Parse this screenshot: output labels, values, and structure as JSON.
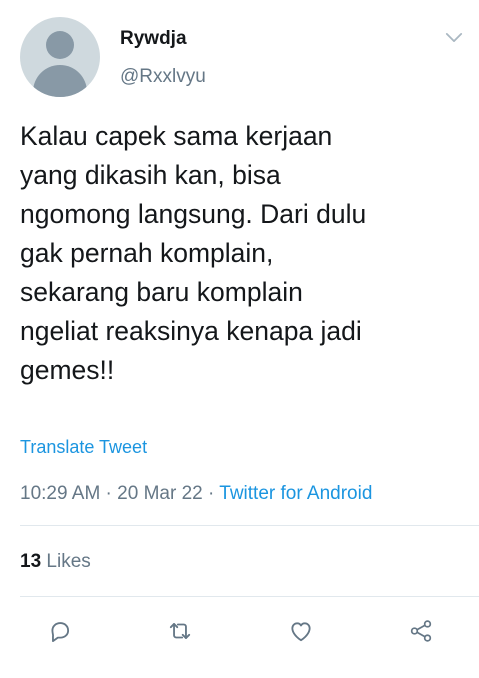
{
  "author": {
    "display_name": "Rywdja",
    "handle": "@Rxxlvyu"
  },
  "icons": {
    "caret": "chevron-down-icon",
    "reply": "reply-icon",
    "retweet": "retweet-icon",
    "like": "heart-icon",
    "share": "share-icon"
  },
  "tweet": {
    "text": "Kalau capek sama kerjaan\nyang dikasih kan, bisa\nngomong langsung. Dari dulu\ngak pernah komplain,\nsekarang baru komplain\nngeliat reaksinya kenapa jadi\ngemes!!",
    "translate_label": "Translate Tweet",
    "time": "10:29 AM",
    "separator": " · ",
    "date": "20 Mar 22",
    "source": "Twitter for Android"
  },
  "stats": {
    "likes_count": "13",
    "likes_label": " Likes"
  },
  "colors": {
    "link": "#1b95e0",
    "secondary_text": "#657786",
    "primary_text": "#14171a",
    "divider": "#e1e8ed"
  }
}
